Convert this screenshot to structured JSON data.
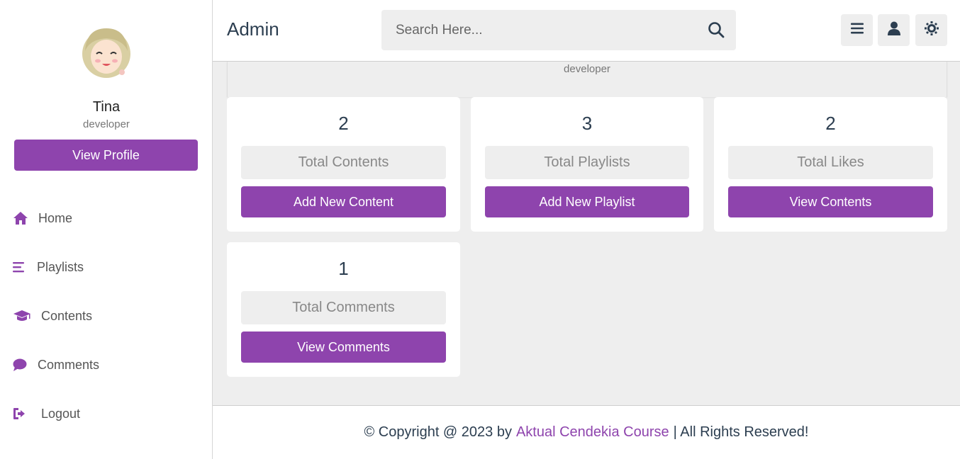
{
  "header": {
    "title": "Admin",
    "search_placeholder": "Search Here..."
  },
  "sidebar": {
    "profile": {
      "name": "Tina",
      "role": "developer",
      "button_label": "View Profile"
    },
    "nav": [
      {
        "label": "Home",
        "icon": "home-icon"
      },
      {
        "label": "Playlists",
        "icon": "bars-icon"
      },
      {
        "label": "Contents",
        "icon": "graduation-cap-icon"
      },
      {
        "label": "Comments",
        "icon": "comment-icon"
      },
      {
        "label": "Logout",
        "icon": "logout-icon"
      }
    ]
  },
  "profile_strip": {
    "role": "developer"
  },
  "cards": [
    {
      "count": "2",
      "label": "Total Contents",
      "button": "Add New Content"
    },
    {
      "count": "3",
      "label": "Total Playlists",
      "button": "Add New Playlist"
    },
    {
      "count": "2",
      "label": "Total Likes",
      "button": "View Contents"
    },
    {
      "count": "1",
      "label": "Total Comments",
      "button": "View Comments"
    }
  ],
  "footer": {
    "prefix": "© Copyright @ 2023 by",
    "link": "Aktual Cendekia Course",
    "suffix": "| All Rights Reserved!"
  },
  "colors": {
    "accent": "#8e44ad",
    "text": "#2c3e50",
    "background": "#eeeeee"
  }
}
